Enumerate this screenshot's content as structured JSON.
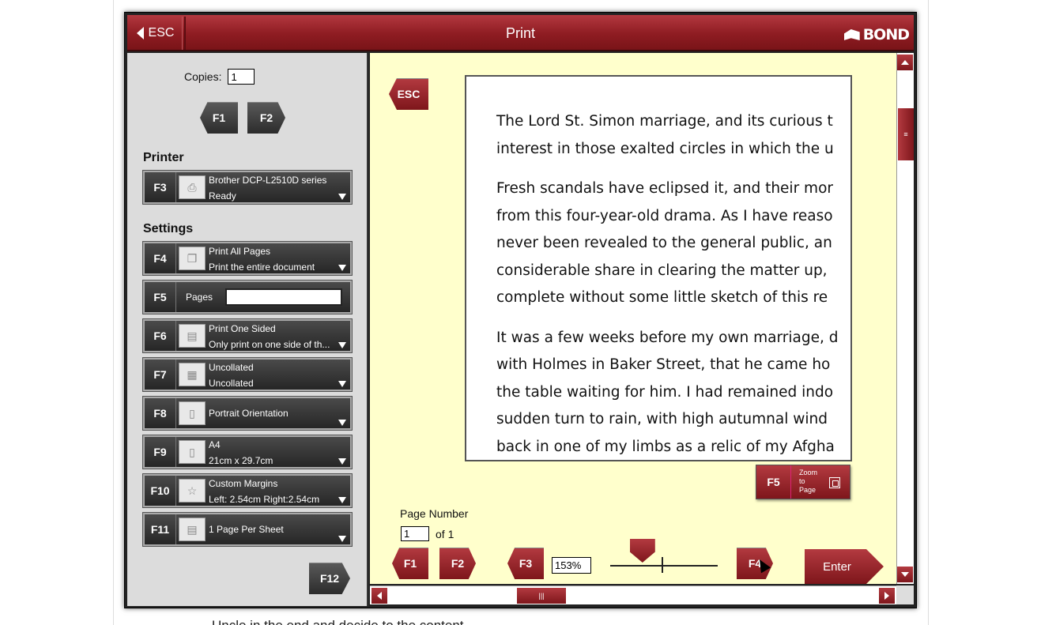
{
  "background_text": "Uncle in the end and decide to the content",
  "titlebar": {
    "esc_label": "ESC",
    "title": "Print",
    "logo": "BOND"
  },
  "sidebar": {
    "copies_label": "Copies:",
    "copies_value": "1",
    "copies_dec_key": "F1",
    "copies_inc_key": "F2",
    "printer_heading": "Printer",
    "printer": {
      "key": "F3",
      "name": "Brother DCP-L2510D series",
      "status": "Ready"
    },
    "settings_heading": "Settings",
    "settings": [
      {
        "key": "F4",
        "line1": "Print All Pages",
        "line2": "Print the entire document"
      },
      {
        "key": "F5",
        "pages_label": "Pages",
        "pages_value": ""
      },
      {
        "key": "F6",
        "line1": "Print One Sided",
        "line2": "Only print on one side of th..."
      },
      {
        "key": "F7",
        "line1": "Uncollated",
        "line2": "Uncollated"
      },
      {
        "key": "F8",
        "line1": "Portrait Orientation",
        "line2": ""
      },
      {
        "key": "F9",
        "line1": "A4",
        "line2": "21cm x 29.7cm"
      },
      {
        "key": "F10",
        "line1": "Custom Margins",
        "line2": "Left: 2.54cm    Right:2.54cm"
      },
      {
        "key": "F11",
        "line1": "1 Page Per Sheet",
        "line2": ""
      }
    ],
    "print_key": "F12"
  },
  "preview": {
    "esc_label": "ESC",
    "paragraphs": [
      [
        "The Lord St. Simon marriage, and its curious t",
        "interest in those exalted circles in which the u"
      ],
      [
        "Fresh scandals have eclipsed it, and their mor",
        "from this four-year-old drama. As I have reaso",
        "never been revealed to the general public, an",
        "considerable share in clearing the matter up,",
        "complete without some little sketch of this re"
      ],
      [
        "It was a few weeks before my own marriage, d",
        "with Holmes in Baker Street, that he came ho",
        "the table waiting for him. I had remained indo",
        "sudden turn to rain, with high autumnal wind",
        "back in one of my limbs as a relic of my Afgha"
      ]
    ],
    "zoom_to_page": {
      "key": "F5",
      "label": "Zoom to Page"
    },
    "page_number_label": "Page Number",
    "page_number_value": "1",
    "page_of": "of 1",
    "prev_key": "F1",
    "next_key": "F2",
    "zoom_out_key": "F3",
    "zoom_value": "153%",
    "zoom_level": 0.3,
    "zoom_in_key": "F4",
    "enter_label": "Enter"
  }
}
